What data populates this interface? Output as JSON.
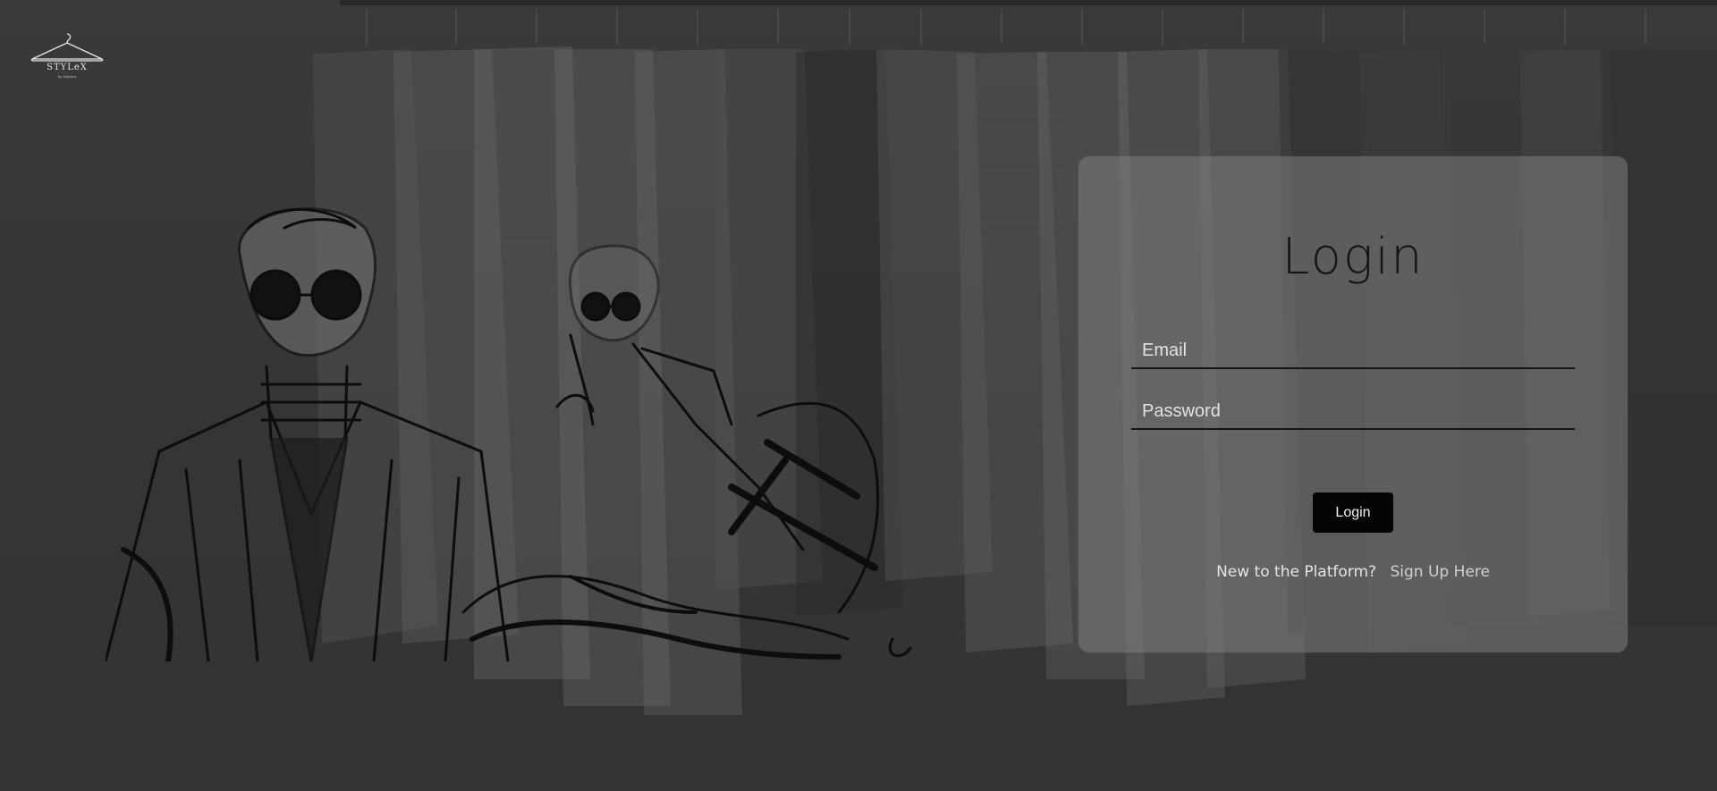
{
  "brand": {
    "logo_text": "STYLeX",
    "logo_subtext": "by Myntra"
  },
  "login_card": {
    "title": "Login",
    "email_placeholder": "Email",
    "password_placeholder": "Password",
    "submit_label": "Login",
    "signup_prompt": "New to the Platform?",
    "signup_link": "Sign Up Here"
  },
  "colors": {
    "background": "#3d3d3d",
    "card": "#7d7d7d",
    "button": "#050505",
    "title": "#161616"
  },
  "icons": {
    "logo": "hanger-logo-icon"
  }
}
